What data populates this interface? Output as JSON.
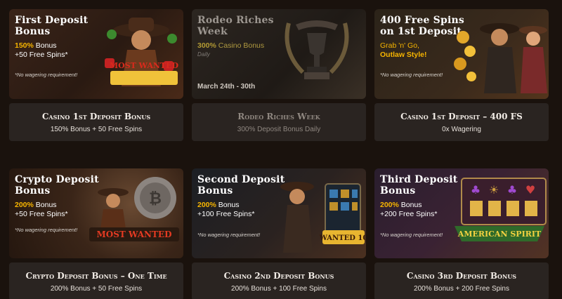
{
  "promotions": [
    {
      "title": "First Deposit Bonus",
      "highlight_value": "150%",
      "highlight_rest": " Bonus",
      "line2": "+50 Free Spins*",
      "note": "*No wagering requirement!",
      "art_label": "MOST WANTED",
      "footer_title": "Casino 1st Deposit Bonus",
      "footer_sub": "150% Bonus + 50 Free Spins"
    },
    {
      "title": "Rodeo Riches Week",
      "highlight_value": "300%",
      "highlight_rest": " Casino Bonus",
      "sub": "Daily",
      "dates": "March 24th - 30th",
      "footer_title": "Rodeo Riches Week",
      "footer_sub": "300% Deposit Bonus Daily"
    },
    {
      "title": "400 Free Spins on 1st Deposit",
      "line1": "Grab 'n' Go,",
      "line2": "Outlaw Style!",
      "note": "*No wagering requirement!",
      "footer_title": "Casino 1st Deposit – 400 FS",
      "footer_sub": "0x Wagering"
    },
    {
      "title": "Crypto Deposit Bonus",
      "highlight_value": "200%",
      "highlight_rest": " Bonus",
      "line2": "+50 Free Spins*",
      "note": "*No wagering requirement!",
      "art_label": "MOST WANTED",
      "footer_title": "Crypto Deposit Bonus – One Time",
      "footer_sub": "200% Bonus + 50 Free Spins"
    },
    {
      "title": "Second Deposit Bonus",
      "highlight_value": "200%",
      "highlight_rest": " Bonus",
      "line2": "+100 Free Spins*",
      "note": "*No wagering requirement!",
      "art_label": "WANTED 10",
      "footer_title": "Casino 2nd Deposit Bonus",
      "footer_sub": "200% Bonus + 100 Free Spins"
    },
    {
      "title": "Third Deposit Bonus",
      "highlight_value": "200%",
      "highlight_rest": " Bonus",
      "line2": "+200 Free Spins*",
      "note": "*No wagering requirement!",
      "art_label": "AMERICAN SPIRIT",
      "footer_title": "Casino 3rd Deposit Bonus",
      "footer_sub": "200% Bonus + 200 Free Spins"
    }
  ]
}
